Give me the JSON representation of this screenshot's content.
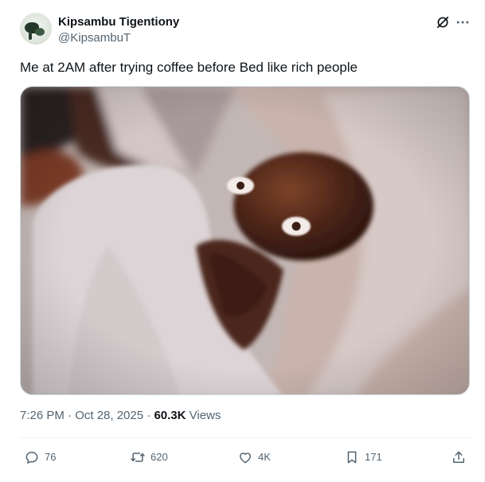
{
  "author": {
    "name": "Kipsambu Tigentiony",
    "handle": "@KipsambuT"
  },
  "tweet": {
    "text": "Me at 2AM after trying coffee before Bed like rich people",
    "timestamp": "7:26 PM · Oct 28, 2025",
    "separator": " · ",
    "views_count": "60.3K",
    "views_label": "Views"
  },
  "actions": {
    "reply_count": "76",
    "repost_count": "620",
    "like_count": "4K",
    "bookmark_count": "171"
  },
  "icons": {
    "grok": "grok-icon",
    "more": "more-icon",
    "reply": "reply-icon",
    "repost": "repost-icon",
    "like": "like-icon",
    "bookmark": "bookmark-icon",
    "share": "share-icon"
  },
  "colors": {
    "text_primary": "#0f1419",
    "text_secondary": "#536471",
    "border": "#cfd9de",
    "divider": "#eff3f4"
  }
}
